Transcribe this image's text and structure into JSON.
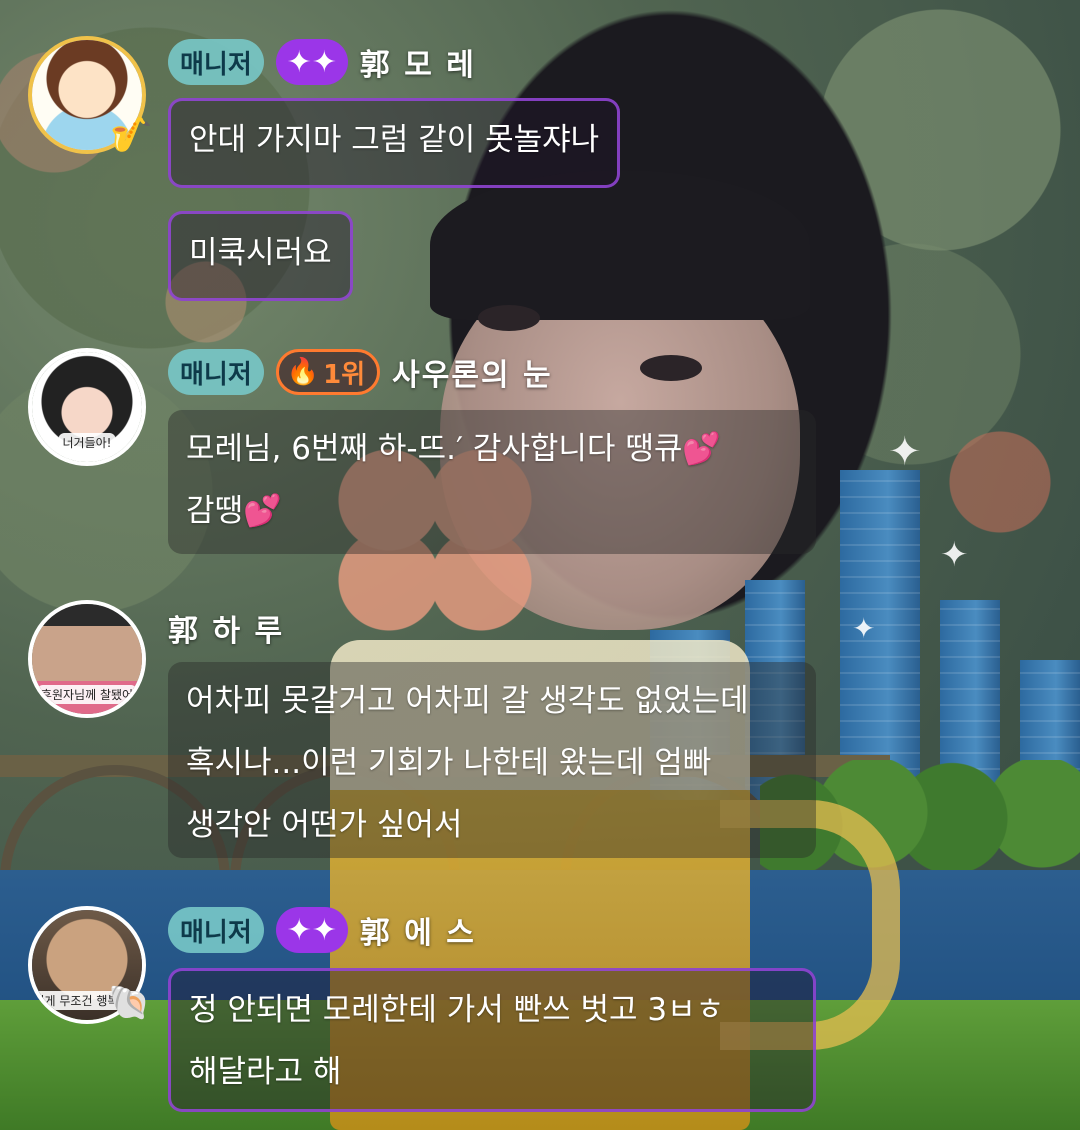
{
  "messages": [
    {
      "role": "매니저",
      "nickname": "郭 모 레",
      "badge_icon": "sparkle-icon",
      "bubbles": [
        [
          "안대 가지마 그럼 같이 못놀쟈나"
        ],
        [
          "미쿡시러요"
        ]
      ]
    },
    {
      "role": "매니저",
      "nickname": "사우론의 눈",
      "rank": "1위",
      "rank_icon": "fire-icon",
      "avatar_label": "너거들아!",
      "bubbles": [
        [
          "모레님, 6번째 하-뜨.′ 감사합니다 땡큐💕",
          "감땡💕"
        ]
      ]
    },
    {
      "nickname": "郭 하 루",
      "avatar_label": "후원자님께 찰됐어",
      "bubbles": [
        [
          "어차피 못갈거고 어차피 갈 생각도 없었는데",
          "혹시나...이런 기회가 나한테 왔는데 엄빠",
          "생각안 어떤가 싶어서"
        ]
      ]
    },
    {
      "role": "매니저",
      "nickname": "郭 에 스",
      "badge_icon": "sparkle-icon",
      "avatar_label": "이게 무조건 행복이야",
      "bubbles": [
        [
          "정 안되면 모레한테 가서 빤쓰 벗고 3ㅂㅎ",
          "해달라고 해"
        ]
      ]
    }
  ],
  "colors": {
    "manager_badge": "#78c8c8",
    "sparkle_badge": "#9b36e8",
    "rank_border": "#ff7a2f",
    "bubble_border": "#9646dc"
  }
}
